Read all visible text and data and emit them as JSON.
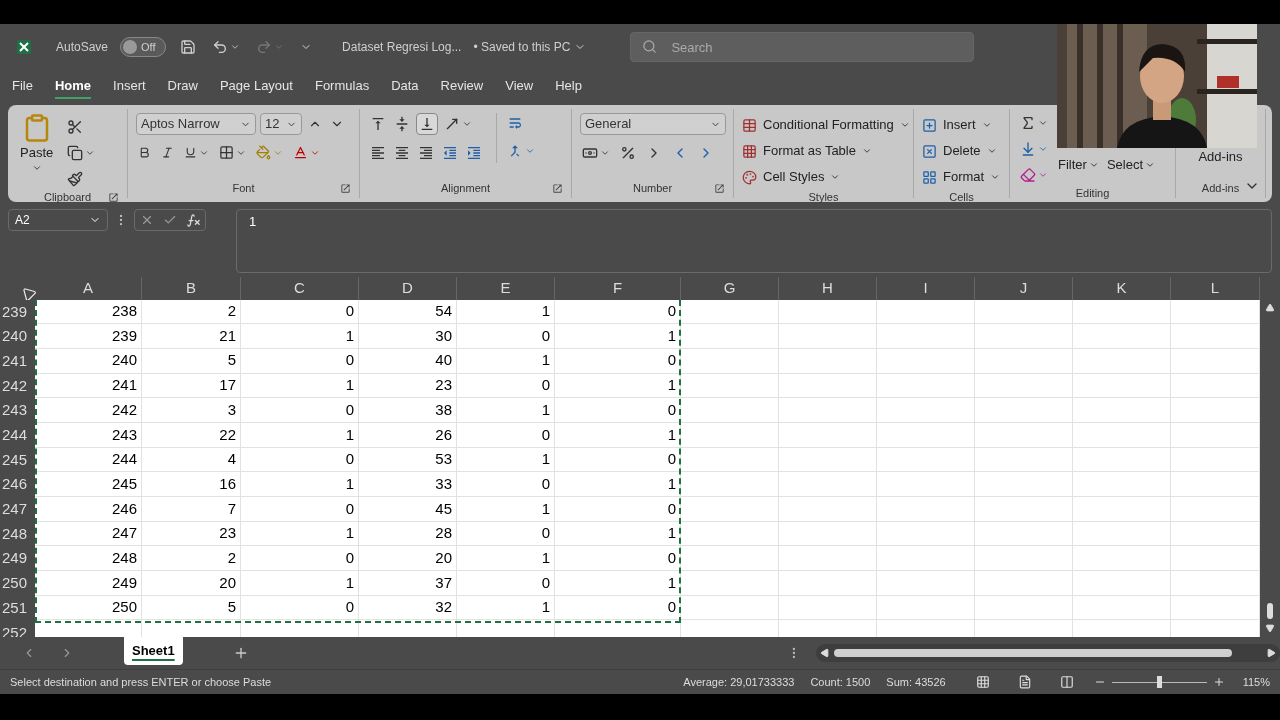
{
  "title_bar": {
    "autosave_label": "AutoSave",
    "autosave": {
      "on": false,
      "label": "Off"
    },
    "document_title": "Dataset Regresi Log...",
    "save_status": "• Saved to this PC",
    "search": {
      "placeholder": "Search"
    }
  },
  "menu_tabs": [
    {
      "label": "File",
      "selected": false
    },
    {
      "label": "Home",
      "selected": true
    },
    {
      "label": "Insert",
      "selected": false
    },
    {
      "label": "Draw",
      "selected": false
    },
    {
      "label": "Page Layout",
      "selected": false
    },
    {
      "label": "Formulas",
      "selected": false
    },
    {
      "label": "Data",
      "selected": false
    },
    {
      "label": "Review",
      "selected": false
    },
    {
      "label": "View",
      "selected": false
    },
    {
      "label": "Help",
      "selected": false
    }
  ],
  "ribbon": {
    "groups": [
      {
        "kind": "clipboard",
        "label": "Clipboard",
        "items": [
          "Paste"
        ]
      },
      {
        "kind": "font",
        "label": "Font",
        "items": [
          "Aptos Narrow",
          "12"
        ]
      },
      {
        "kind": "alignment",
        "label": "Alignment"
      },
      {
        "kind": "number",
        "label": "Number",
        "items": [
          "General"
        ]
      },
      {
        "kind": "styles",
        "label": "Styles",
        "items": [
          "Conditional Formatting",
          "Format as Table",
          "Cell Styles"
        ]
      },
      {
        "kind": "cells",
        "label": "Cells",
        "items": [
          "Insert",
          "Delete",
          "Format"
        ]
      },
      {
        "kind": "editing",
        "label": "Editing",
        "items": [
          "Filter",
          "Select"
        ]
      },
      {
        "kind": "addins",
        "label": "Add-ins",
        "items": [
          "Add-ins"
        ]
      }
    ]
  },
  "formula_bar": {
    "name_box": "A2",
    "formula": "1"
  },
  "sheet": {
    "columns": [
      "A",
      "B",
      "C",
      "D",
      "E",
      "F",
      "G",
      "H",
      "I",
      "J",
      "K",
      "L"
    ],
    "copy_marquee": true,
    "rows": [
      {
        "header": "239",
        "cells": [
          "238",
          "2",
          "0",
          "54",
          "1",
          "0"
        ]
      },
      {
        "header": "240",
        "cells": [
          "239",
          "21",
          "1",
          "30",
          "0",
          "1"
        ]
      },
      {
        "header": "241",
        "cells": [
          "240",
          "5",
          "0",
          "40",
          "1",
          "0"
        ]
      },
      {
        "header": "242",
        "cells": [
          "241",
          "17",
          "1",
          "23",
          "0",
          "1"
        ]
      },
      {
        "header": "243",
        "cells": [
          "242",
          "3",
          "0",
          "38",
          "1",
          "0"
        ]
      },
      {
        "header": "244",
        "cells": [
          "243",
          "22",
          "1",
          "26",
          "0",
          "1"
        ]
      },
      {
        "header": "245",
        "cells": [
          "244",
          "4",
          "0",
          "53",
          "1",
          "0"
        ]
      },
      {
        "header": "246",
        "cells": [
          "245",
          "16",
          "1",
          "33",
          "0",
          "1"
        ]
      },
      {
        "header": "247",
        "cells": [
          "246",
          "7",
          "0",
          "45",
          "1",
          "0"
        ]
      },
      {
        "header": "248",
        "cells": [
          "247",
          "23",
          "1",
          "28",
          "0",
          "1"
        ]
      },
      {
        "header": "249",
        "cells": [
          "248",
          "2",
          "0",
          "20",
          "1",
          "0"
        ]
      },
      {
        "header": "250",
        "cells": [
          "249",
          "20",
          "1",
          "37",
          "0",
          "1"
        ]
      },
      {
        "header": "251",
        "cells": [
          "250",
          "5",
          "0",
          "32",
          "1",
          "0"
        ]
      },
      {
        "header": "252",
        "cells": []
      }
    ]
  },
  "sheet_tabs": [
    {
      "label": "Sheet1",
      "selected": true
    }
  ],
  "status_bar": {
    "message": "Select destination and press ENTER or choose Paste",
    "average": "Average: 29,01733333",
    "count": "Count: 1500",
    "sum": "Sum: 43526",
    "zoom": {
      "level": 0.5,
      "label": "115%"
    }
  }
}
